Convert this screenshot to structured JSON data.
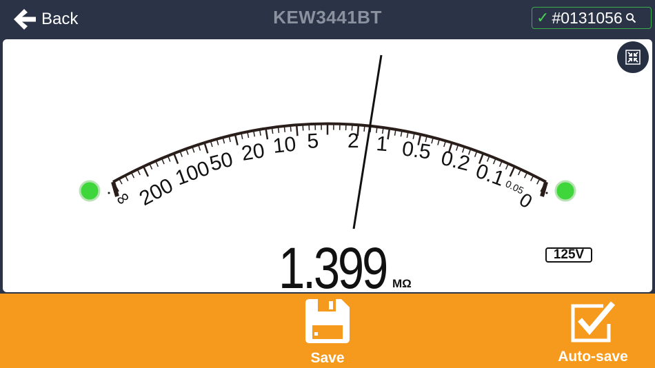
{
  "header": {
    "back_label": "Back",
    "title": "KEW3441BT",
    "serial": "#0131056"
  },
  "meter": {
    "reading": "1.399",
    "unit": "MΩ",
    "voltage": "125V",
    "scale_labels": [
      "∞",
      "200",
      "100",
      "50",
      "20",
      "10",
      "5",
      "2",
      "1",
      "0.5",
      "0.2",
      "0.1",
      "0.05",
      "0"
    ],
    "needle_value": "1.399",
    "status_left_color": "#3ed63a",
    "status_right_color": "#3ed63a"
  },
  "footer": {
    "save_label": "Save",
    "autosave_label": "Auto-save"
  },
  "colors": {
    "header_bg": "#2b3446",
    "footer_bg": "#f59a1c",
    "check_green": "#3bb04a"
  }
}
